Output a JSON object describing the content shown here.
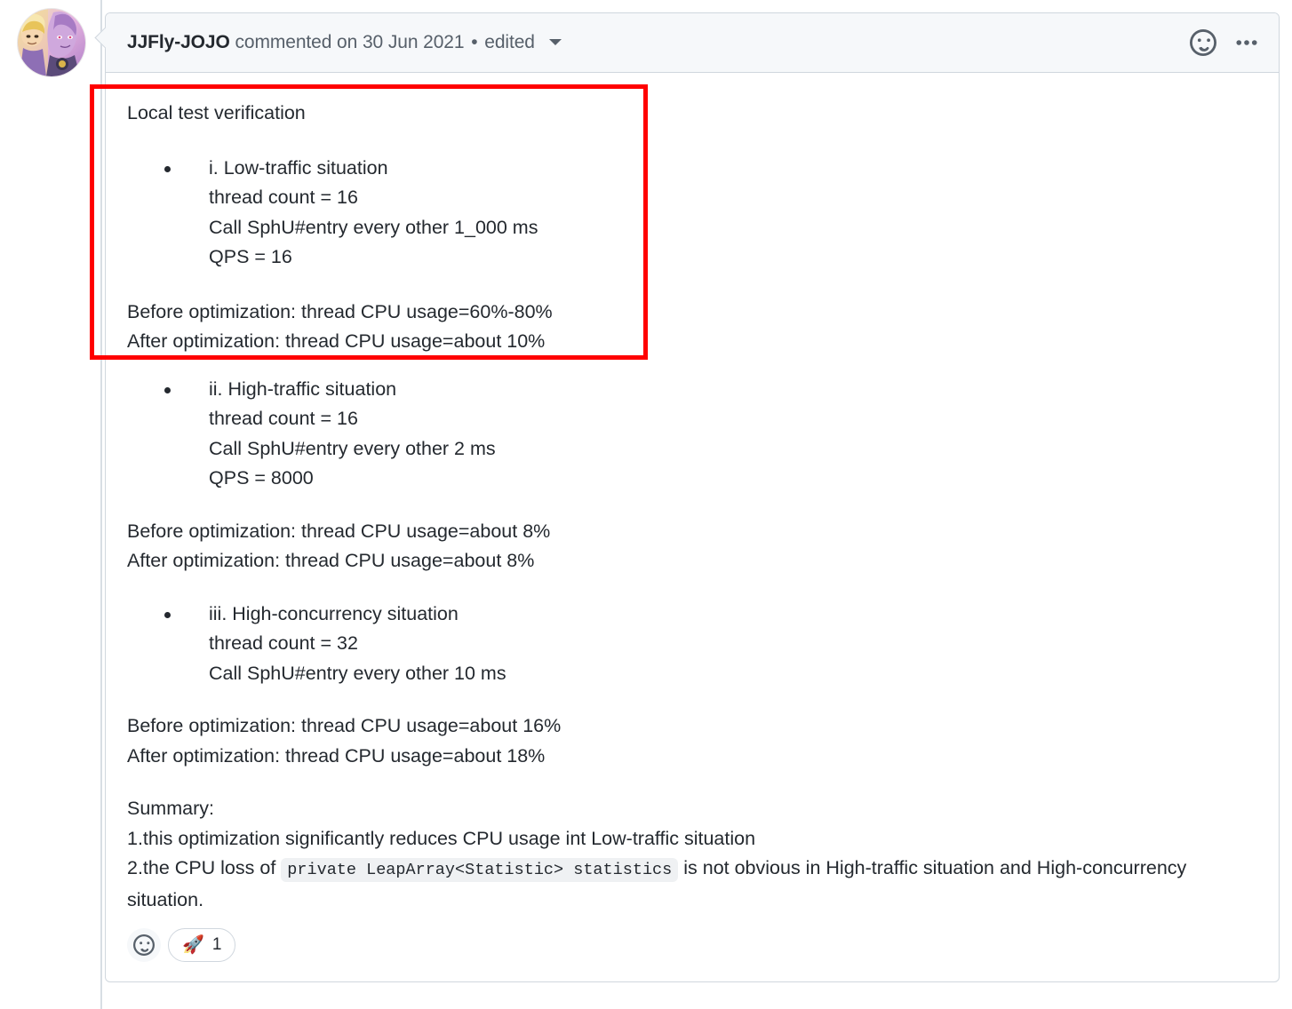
{
  "comment": {
    "author": "JJFly-JOJO",
    "action": "commented on",
    "date": "30 Jun 2021",
    "separator": "•",
    "edited_label": "edited",
    "avatar_name": "jjfly-jojo-avatar",
    "header_icons": {
      "reaction_icon": "smiley-icon",
      "menu_icon": "kebab-menu-icon",
      "caret_icon": "chevron-down-icon"
    }
  },
  "body": {
    "intro": "Local test verification",
    "cases": [
      {
        "title": "i. Low-traffic situation",
        "lines": [
          "thread count = 16",
          "Call SphU#entry every other 1_000 ms",
          "QPS = 16"
        ],
        "before": "Before optimization: thread CPU usage=60%-80%",
        "after": "After optimization: thread CPU usage=about 10%"
      },
      {
        "title": "ii. High-traffic situation",
        "lines": [
          "thread count = 16",
          "Call SphU#entry every other 2 ms",
          "QPS = 8000"
        ],
        "before": "Before optimization: thread CPU usage=about 8%",
        "after": "After optimization: thread CPU usage=about 8%"
      },
      {
        "title": "iii. High-concurrency situation",
        "lines": [
          "thread count = 32",
          "Call SphU#entry every other 10 ms"
        ],
        "before": "Before optimization: thread CPU usage=about 16%",
        "after": "After optimization: thread CPU usage=about 18%"
      }
    ],
    "summary": {
      "heading": "Summary:",
      "point1": "1.this optimization significantly reduces CPU usage int Low-traffic situation",
      "point2_prefix": "2.the CPU loss of ",
      "point2_code": "private LeapArray<Statistic> statistics",
      "point2_suffix": " is not obvious in High-traffic situation and High-concurrency situation."
    }
  },
  "reactions": {
    "add_label": "add-reaction",
    "items": [
      {
        "emoji": "🚀",
        "count": "1",
        "name": "rocket"
      }
    ]
  },
  "annotation": {
    "color": "#ff0000",
    "label": "red-highlight-box"
  }
}
